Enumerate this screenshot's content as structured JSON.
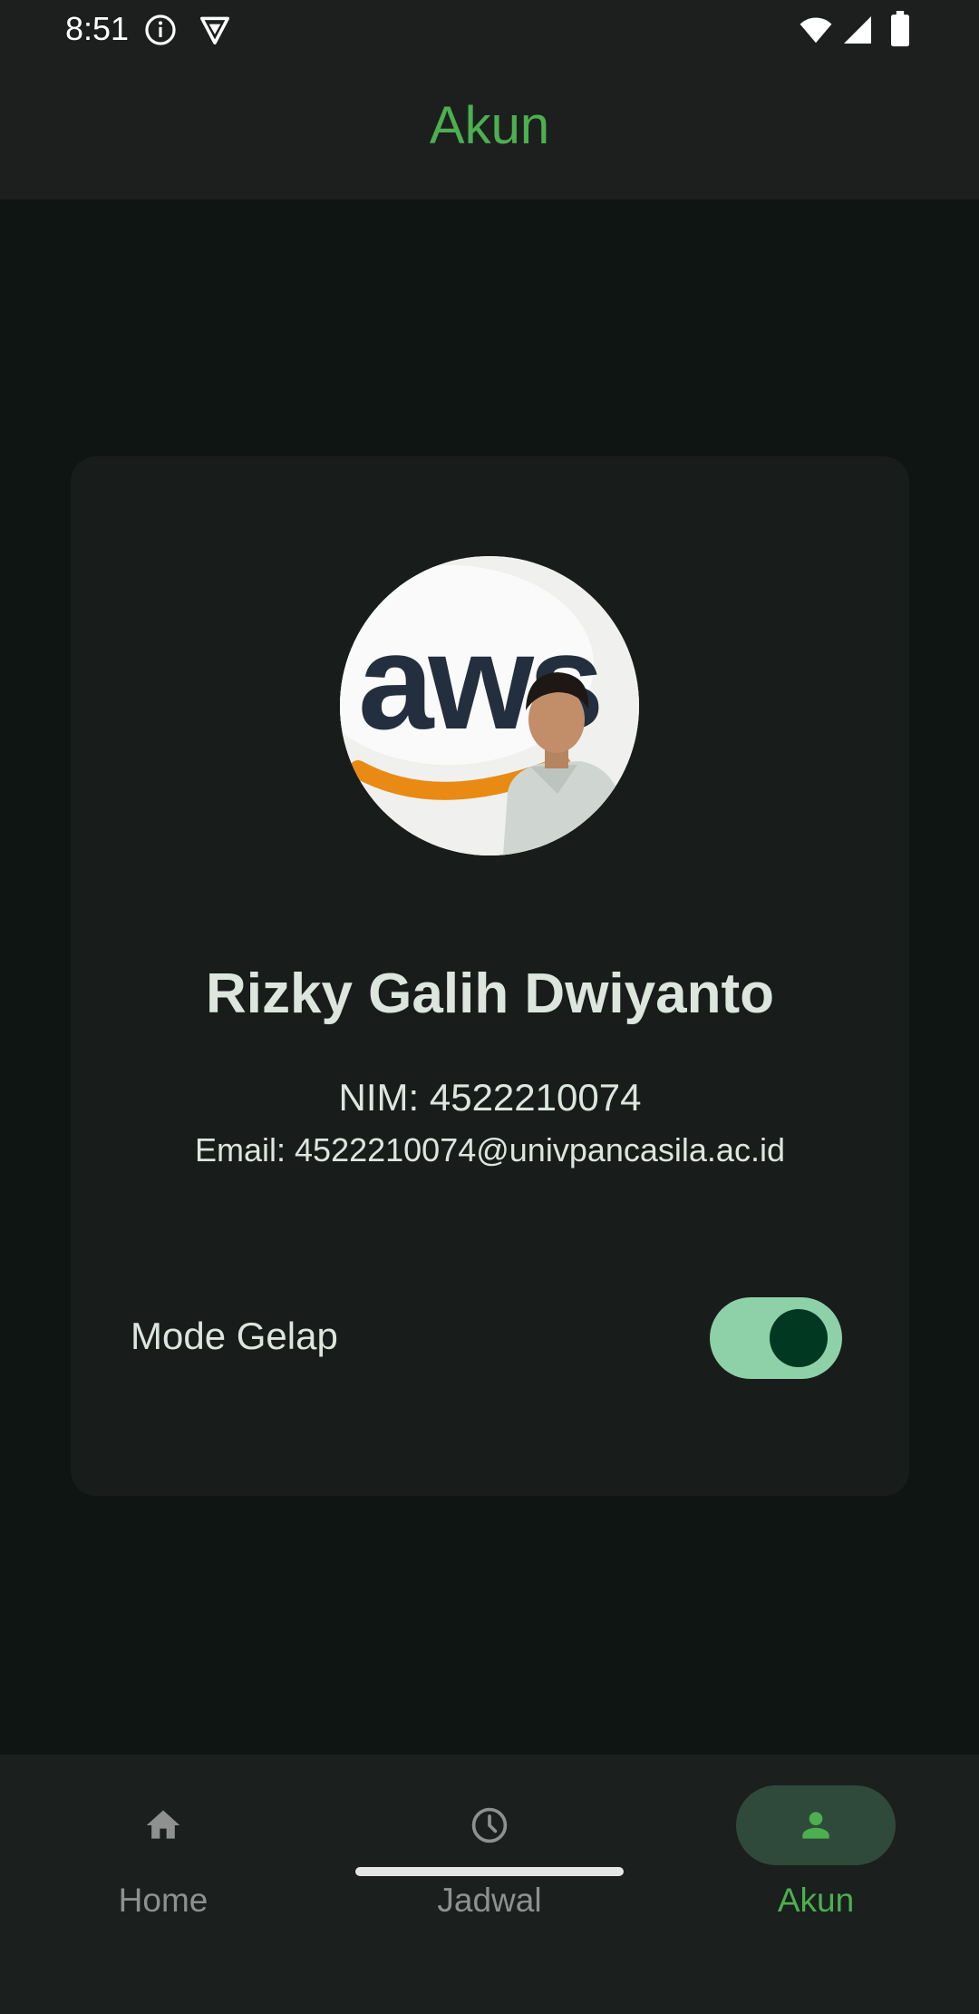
{
  "status_bar": {
    "time": "8:51",
    "icons": [
      "info-icon",
      "vpn-shield-icon",
      "wifi-icon",
      "cell-signal-icon",
      "battery-icon"
    ]
  },
  "app_bar": {
    "title": "Akun"
  },
  "profile": {
    "avatar_logo_text": "aws",
    "name": "Rizky Galih Dwiyanto",
    "nim": "NIM: 4522210074",
    "email": "Email: 4522210074@univpancasila.ac.id"
  },
  "settings": {
    "dark_mode_label": "Mode Gelap",
    "dark_mode_enabled": true
  },
  "bottom_nav": {
    "items": [
      {
        "label": "Home",
        "icon": "home-icon",
        "active": false
      },
      {
        "label": "Jadwal",
        "icon": "clock-icon",
        "active": false
      },
      {
        "label": "Akun",
        "icon": "person-icon",
        "active": true
      }
    ]
  },
  "colors": {
    "accent": "#4caf50",
    "background": "#0f1512",
    "card": "#181d1b",
    "toggle_track": "#8ed1a8",
    "toggle_thumb": "#003822",
    "nav_indicator": "#2f4a3a"
  }
}
